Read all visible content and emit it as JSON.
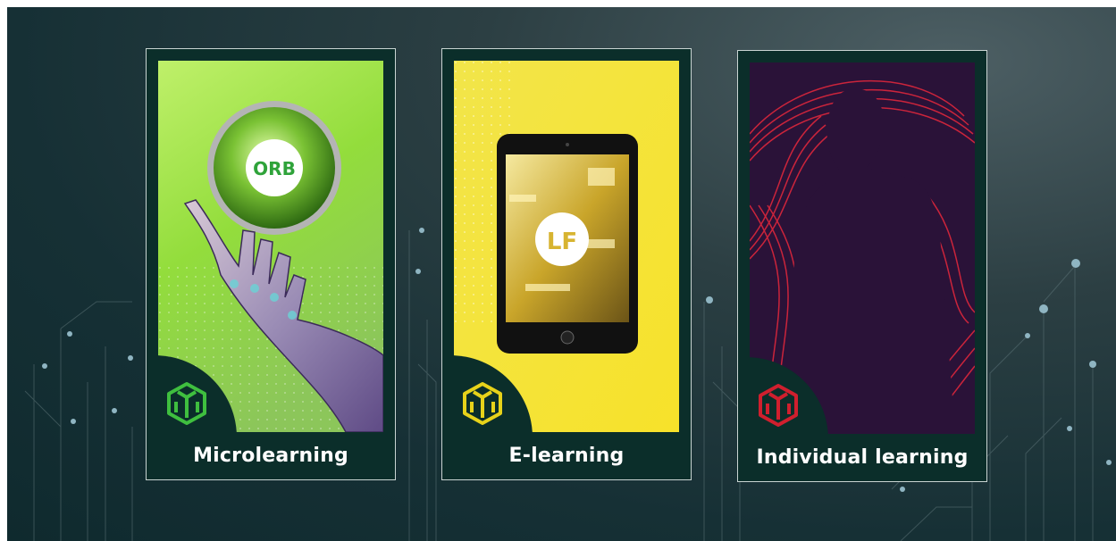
{
  "cards": [
    {
      "label": "Microlearning",
      "logo_text": "ORB",
      "accent": "#3fbf3f"
    },
    {
      "label": "E-learning",
      "logo_text": "LF",
      "accent": "#e7d21a"
    },
    {
      "label": "Individual learning",
      "accent": "#d01f2e"
    }
  ],
  "colors": {
    "background": "#163035",
    "card_frame": "#0b2e2a",
    "card_border": "#c9d4d2"
  }
}
